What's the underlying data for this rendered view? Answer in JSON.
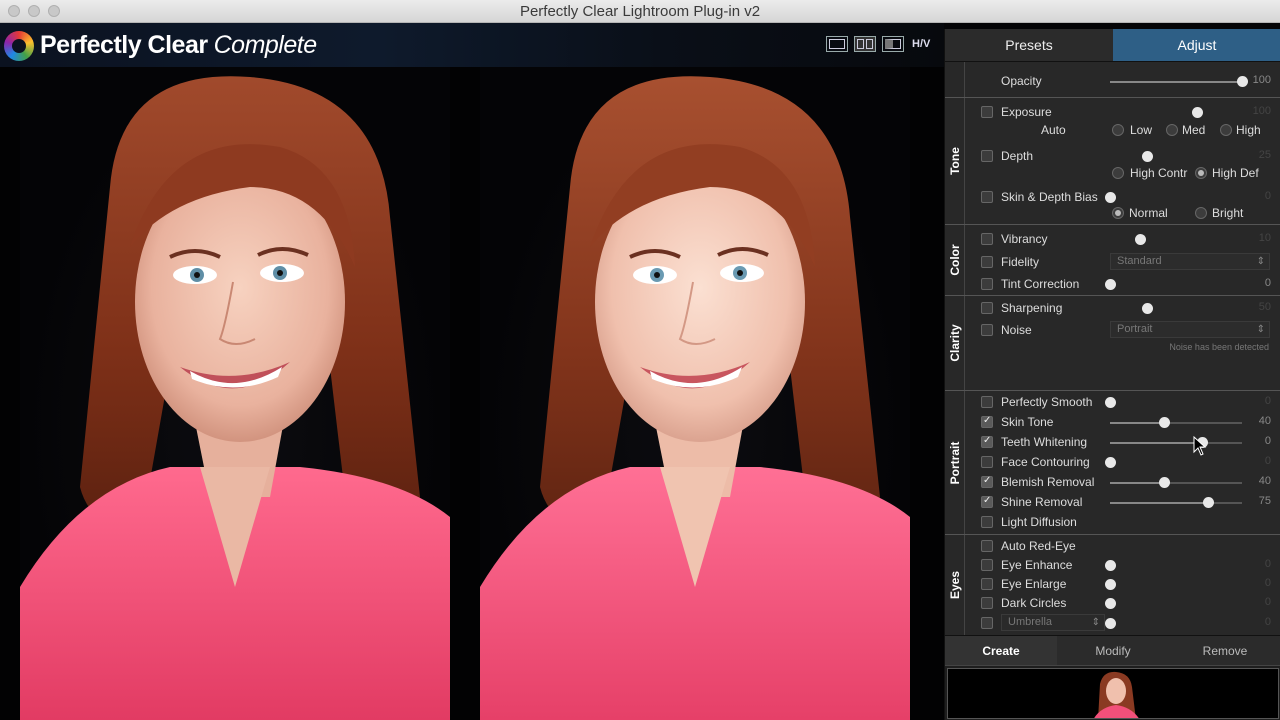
{
  "window": {
    "title": "Perfectly Clear Lightroom Plug-in v2"
  },
  "header": {
    "brand": "Perfectly Clear",
    "brand_suffix": "Complete",
    "view_hv_label": "H/V"
  },
  "panel": {
    "tabs": [
      {
        "label": "Presets",
        "active": false
      },
      {
        "label": "Adjust",
        "active": true
      }
    ],
    "opacity": {
      "label": "Opacity",
      "value": "100",
      "level": 1.0
    },
    "tone": {
      "title": "Tone",
      "exposure": {
        "label": "Exposure",
        "value": "100",
        "checked": false,
        "level": 0.66
      },
      "auto": {
        "label": "Auto",
        "options": [
          "Low",
          "Med",
          "High"
        ]
      },
      "depth": {
        "label": "Depth",
        "value": "25",
        "checked": false,
        "level": 0.28
      },
      "depth_modes": [
        "High Contr",
        "High Def"
      ],
      "depth_mode_selected": "High Def",
      "bias": {
        "label": "Skin & Depth Bias",
        "value": "0",
        "checked": false,
        "level": 0.0
      },
      "bias_modes": [
        "Normal",
        "Bright"
      ],
      "bias_mode_selected": "Normal"
    },
    "color": {
      "title": "Color",
      "vibrancy": {
        "label": "Vibrancy",
        "value": "10",
        "checked": false,
        "level": 0.23
      },
      "fidelity": {
        "label": "Fidelity",
        "select": "Standard",
        "checked": false
      },
      "tint": {
        "label": "Tint Correction",
        "value": "0",
        "checked": false,
        "level": 0.0
      }
    },
    "clarity": {
      "title": "Clarity",
      "sharpening": {
        "label": "Sharpening",
        "value": "50",
        "checked": false,
        "level": 0.28
      },
      "noise": {
        "label": "Noise",
        "select": "Portrait",
        "checked": false
      },
      "noise_note": "Noise has been detected"
    },
    "portrait": {
      "title": "Portrait",
      "items": [
        {
          "label": "Perfectly Smooth",
          "value": "0",
          "checked": false,
          "level": 0.0
        },
        {
          "label": "Skin Tone",
          "value": "40",
          "checked": true,
          "level": 0.41
        },
        {
          "label": "Teeth Whitening",
          "value": "0",
          "checked": true,
          "level": 0.7
        },
        {
          "label": "Face Contouring",
          "value": "0",
          "checked": false,
          "level": 0.0
        },
        {
          "label": "Blemish Removal",
          "value": "40",
          "checked": true,
          "level": 0.41
        },
        {
          "label": "Shine Removal",
          "value": "75",
          "checked": true,
          "level": 0.74
        },
        {
          "label": "Light Diffusion",
          "value": "",
          "checked": false,
          "level": null
        }
      ]
    },
    "eyes": {
      "title": "Eyes",
      "items": [
        {
          "label": "Auto Red-Eye",
          "value": "",
          "checked": false,
          "level": null
        },
        {
          "label": "Eye Enhance",
          "value": "0",
          "checked": false,
          "level": 0.0
        },
        {
          "label": "Eye Enlarge",
          "value": "0",
          "checked": false,
          "level": 0.0
        },
        {
          "label": "Dark Circles",
          "value": "0",
          "checked": false,
          "level": 0.0
        }
      ],
      "color_select": "Umbrella",
      "color_value": "0"
    },
    "bottom_tabs": [
      {
        "label": "Create",
        "active": true
      },
      {
        "label": "Modify",
        "active": false
      },
      {
        "label": "Remove",
        "active": false
      }
    ]
  },
  "colors": {
    "accent_tab": "#2e5f86",
    "panel_bg": "#282828",
    "shirt": "#f2507a",
    "hair": "#8a3a22"
  }
}
